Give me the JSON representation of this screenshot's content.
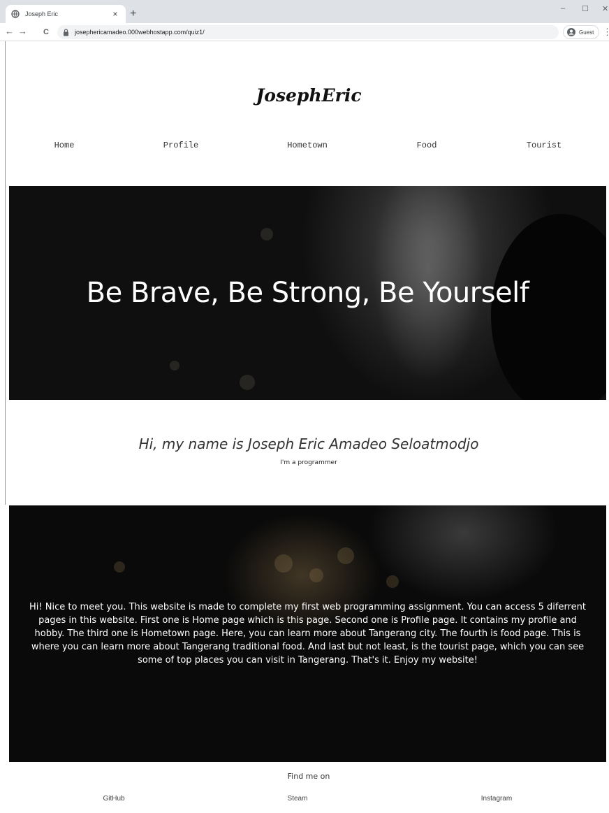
{
  "browser": {
    "tab_title": "Joseph Eric",
    "tab_close": "×",
    "new_tab": "+",
    "url": "josephericamadeo.000webhostapp.com/quiz1/",
    "profile_label": "Guest",
    "window_minimize": "–",
    "window_maximize": "☐",
    "window_close": "✕",
    "back": "←",
    "forward": "→",
    "reload": "C",
    "menu": "⋮"
  },
  "site": {
    "logo": "JosephEric",
    "nav": [
      "Home",
      "Profile",
      "Hometown",
      "Food",
      "Tourist"
    ],
    "hero_heading": "Be Brave, Be Strong, Be Yourself",
    "intro_name": "Hi, my name is Joseph Eric Amadeo Seloatmodjo",
    "intro_role": "I'm a programmer",
    "about_text": "Hi! Nice to meet you. This website is made to complete my first web programming assignment. You can access 5 diferrent pages in this website. First one is Home page which is this page. Second one is Profile page. It contains my profile and hobby. The third one is Hometown page. Here, you can learn more about Tangerang city. The fourth is food page. This is where you can learn more about Tangerang traditional food. And last but not least, is the tourist page, which you can see some of top places you can visit in Tangerang. That's it. Enjoy my website!",
    "footer_heading": "Find me on",
    "social": [
      "GitHub",
      "Steam",
      "Instagram"
    ]
  },
  "icons": {
    "favicon": "globe-icon",
    "lock": "lock-icon",
    "avatar": "account-circle-icon"
  }
}
